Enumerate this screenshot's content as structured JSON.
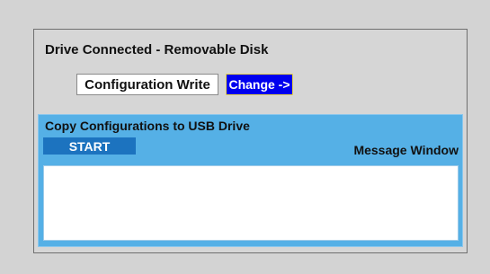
{
  "drive": {
    "status_label": "Drive Connected - Removable Disk"
  },
  "buttons": {
    "configuration_write": "Configuration Write",
    "change": "Change ->"
  },
  "usb": {
    "title": "Copy Configurations to USB Drive",
    "start": "START",
    "message_window_label": "Message Window",
    "message_text": ""
  },
  "colors": {
    "panel_bg": "#d6d6d6",
    "usb_section_bg": "#55b0e6",
    "start_button_bg": "#1c73bf",
    "change_button_bg": "#0000ee",
    "change_button_border": "#e8d64a"
  }
}
